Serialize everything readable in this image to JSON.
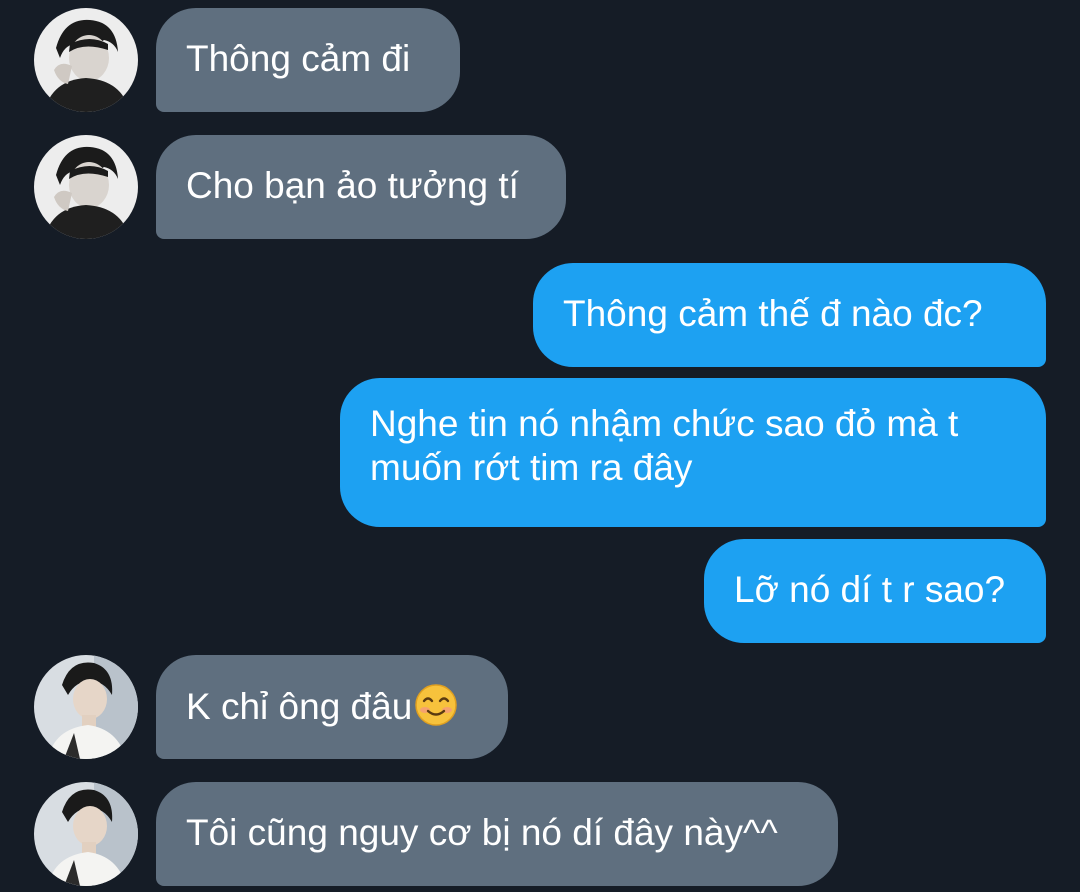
{
  "conversation": {
    "messages": [
      {
        "direction": "received",
        "sender_avatar": "avatar-person-a",
        "text": "Thông cảm đi"
      },
      {
        "direction": "received",
        "sender_avatar": "avatar-person-a",
        "text": "Cho bạn ảo tưởng tí"
      },
      {
        "direction": "sent",
        "text": "Thông cảm thế đ nào đc?"
      },
      {
        "direction": "sent",
        "text_line1": "Nghe tin nó nhậm chức sao đỏ mà t",
        "text_line2": "muốn rớt tim ra đây"
      },
      {
        "direction": "sent",
        "text": "Lỡ nó dí t r sao?"
      },
      {
        "direction": "received",
        "sender_avatar": "avatar-person-b",
        "text": "K chỉ ông đâu",
        "emoji": "smiling-face-with-smiling-eyes-emoji"
      },
      {
        "direction": "received",
        "sender_avatar": "avatar-person-b",
        "text": "Tôi cũng nguy cơ bị nó dí đây này^^"
      }
    ]
  },
  "colors": {
    "background": "#151c26",
    "received_bubble": "#5f6f7f",
    "sent_bubble": "#1da1f2",
    "text": "#ffffff"
  }
}
